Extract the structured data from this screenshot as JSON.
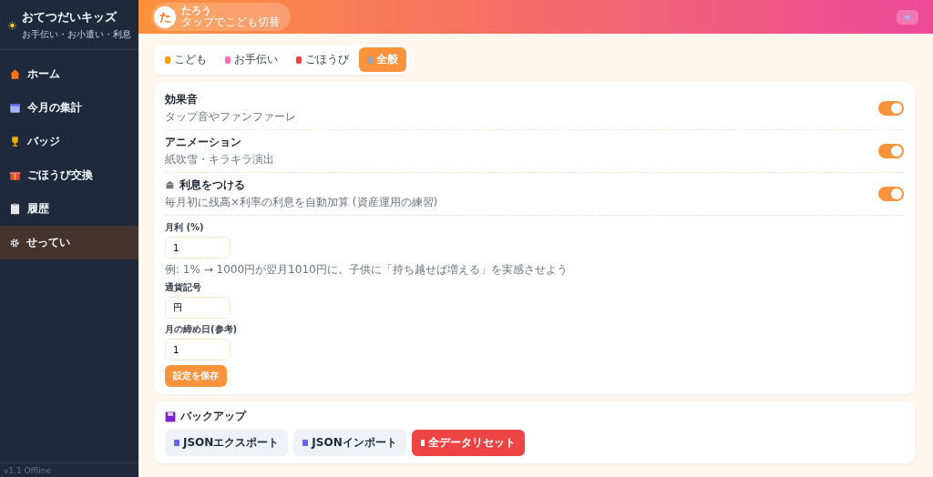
{
  "sidebar": {
    "title": "おてつだいキッズ",
    "subtitle": "お手伝い・お小遣い・利息",
    "items": [
      {
        "label": "ホーム",
        "selected": false
      },
      {
        "label": "今月の集計",
        "selected": false
      },
      {
        "label": "バッジ",
        "selected": false
      },
      {
        "label": "ごほうび交換",
        "selected": false
      },
      {
        "label": "履歴",
        "selected": false
      },
      {
        "label": "せってい",
        "selected": true
      }
    ],
    "footer": "v1.1 Offline"
  },
  "header": {
    "avatar": "た",
    "name": "たろう",
    "hint": "タップでこども切替"
  },
  "tabs": [
    {
      "label": "こども",
      "selected": false
    },
    {
      "label": "お手伝い",
      "selected": false
    },
    {
      "label": "ごほうび",
      "selected": false
    },
    {
      "label": "全般",
      "selected": true
    }
  ],
  "settings": [
    {
      "title": "効果音",
      "description": "タップ音やファンファーレ",
      "on": true
    },
    {
      "title": "アニメーション",
      "description": "紙吹雪・キラキラ演出",
      "on": true
    },
    {
      "title": "利息をつける",
      "description": "毎月初に残高×利率の利息を自動加算 (資産運用の練習)",
      "on": true
    }
  ],
  "fields": [
    {
      "label": "月利 (%)",
      "value": "1",
      "help": "例: 1% → 1000円が翌月1010円に。子供に「持ち越せば増える」を実感させよう"
    },
    {
      "label": "通貨記号",
      "value": "円"
    },
    {
      "label": "月の締め日(参考)",
      "value": "1"
    }
  ],
  "save_button": "設定を保存",
  "backup": {
    "title": "バックアップ",
    "buttons": [
      {
        "label": "JSONエクスポート",
        "kind": "plain"
      },
      {
        "label": "JSONインポート",
        "kind": "plain"
      },
      {
        "label": "全データリセット",
        "kind": "danger"
      }
    ]
  }
}
